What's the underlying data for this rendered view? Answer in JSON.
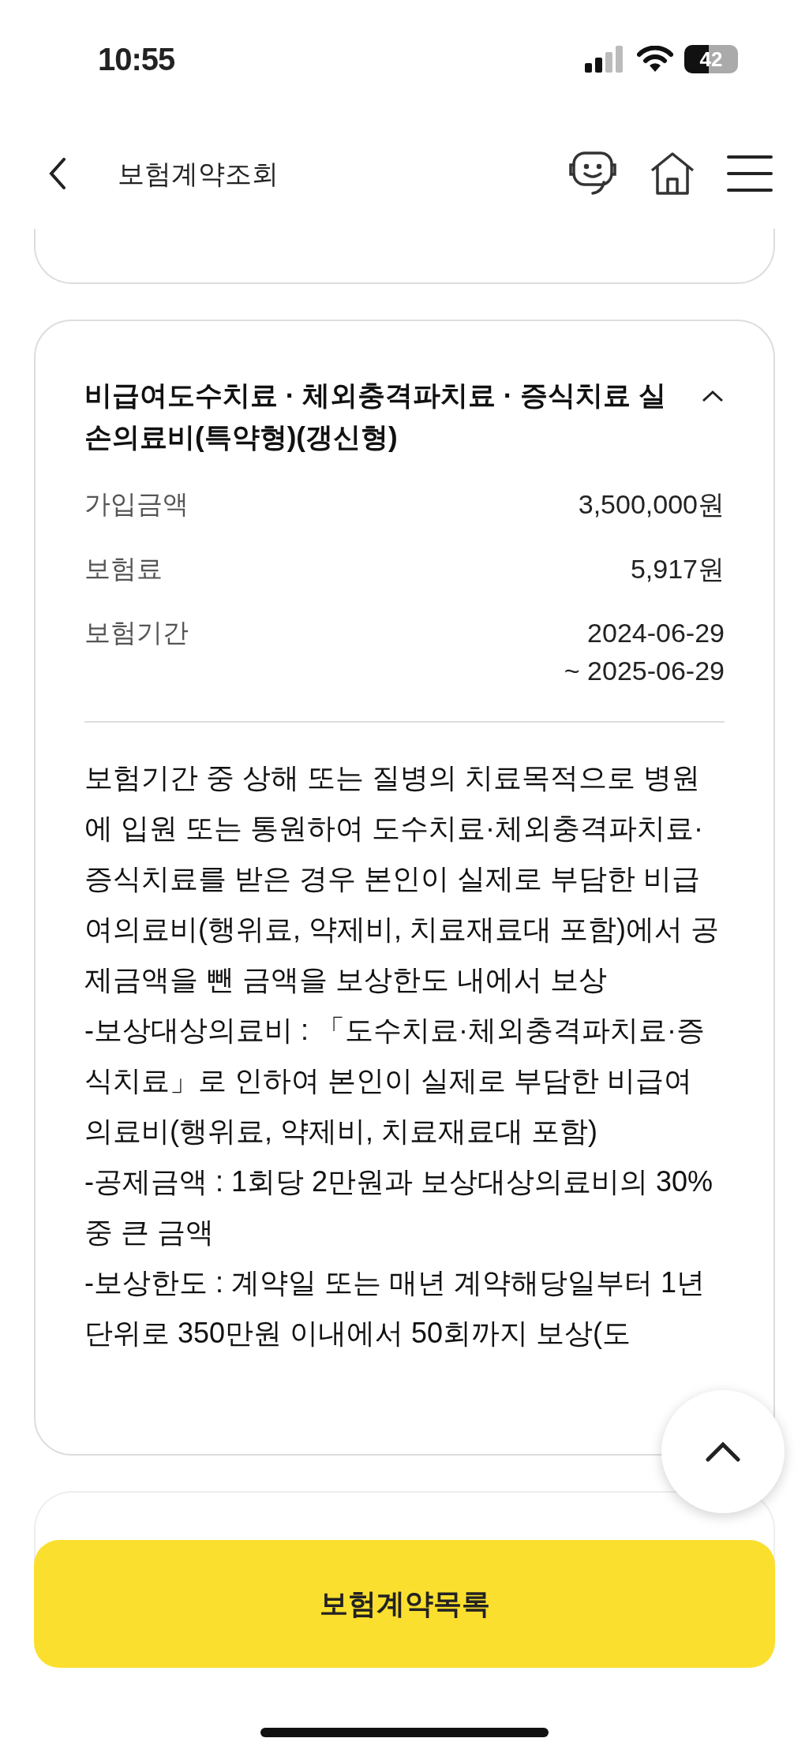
{
  "status_bar": {
    "time": "10:55",
    "battery": "42"
  },
  "header": {
    "title": "보험계약조회"
  },
  "card": {
    "title": "비급여도수치료 · 체외충격파치료 · 증식치료 실손의료비(특약형)(갱신형)",
    "expanded": true,
    "rows": [
      {
        "label": "가입금액",
        "value": [
          "3,500,000원"
        ]
      },
      {
        "label": "보험료",
        "value": [
          "5,917원"
        ]
      },
      {
        "label": "보험기간",
        "value": [
          "2024-06-29",
          "~ 2025-06-29"
        ]
      }
    ],
    "description": [
      "보험기간 중 상해 또는 질병의 치료목적으로 병원에 입원 또는 통원하여 도수치료·체외충격파치료·증식치료를 받은 경우 본인이 실제로 부담한 비급여의료비(행위료, 약제비, 치료재료대 포함)에서 공제금액을 뺀 금액을 보상한도 내에서 보상",
      "-보상대상의료비 : 「도수치료·체외충격파치료·증식치료」로 인하여 본인이 실제로 부담한 비급여 의료비(행위료, 약제비, 치료재료대 포함)",
      "-공제금액 : 1회당 2만원과 보상대상의료비의 30% 중 큰 금액",
      "-보상한도 : 계약일 또는 매년 계약해당일부터 1년 단위로 350만원 이내에서 50회까지 보상(도"
    ]
  },
  "bottom_button": {
    "label": "보험계약목록"
  }
}
